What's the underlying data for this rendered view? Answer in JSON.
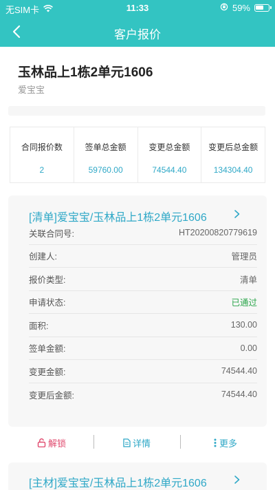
{
  "status": {
    "carrier": "无SIM卡",
    "time": "11:33",
    "battery": "59%"
  },
  "nav": {
    "title": "客户报价"
  },
  "customer": {
    "address": "玉林品上1栋2单元1606",
    "name": "爱宝宝"
  },
  "stats": [
    {
      "label": "合同报价数",
      "value": "2"
    },
    {
      "label": "签单总金额",
      "value": "59760.00"
    },
    {
      "label": "变更总金额",
      "value": "74544.40"
    },
    {
      "label": "变更后总金额",
      "value": "134304.40"
    }
  ],
  "card1": {
    "title": "[清单]爱宝宝/玉林品上1栋2单元1606",
    "rows": [
      {
        "label": "关联合同号:",
        "value": "HT20200820779619"
      },
      {
        "label": "创建人:",
        "value": "管理员"
      },
      {
        "label": "报价类型:",
        "value": "清单"
      },
      {
        "label": "申请状态:",
        "value": "已通过"
      },
      {
        "label": "面积:",
        "value": "130.00"
      },
      {
        "label": "签单金额:",
        "value": "0.00"
      },
      {
        "label": "变更金额:",
        "value": "74544.40"
      },
      {
        "label": "变更后金额:",
        "value": "74544.40"
      }
    ]
  },
  "actions": {
    "unlock": "解锁",
    "detail": "详情",
    "more": "更多"
  },
  "card2": {
    "title": "[主材]爱宝宝/玉林品上1栋2单元1606"
  },
  "colors": {
    "primary": "#33c4c2",
    "link": "#2fa8c7",
    "success": "#2aa54a",
    "danger": "#e04a6e"
  }
}
